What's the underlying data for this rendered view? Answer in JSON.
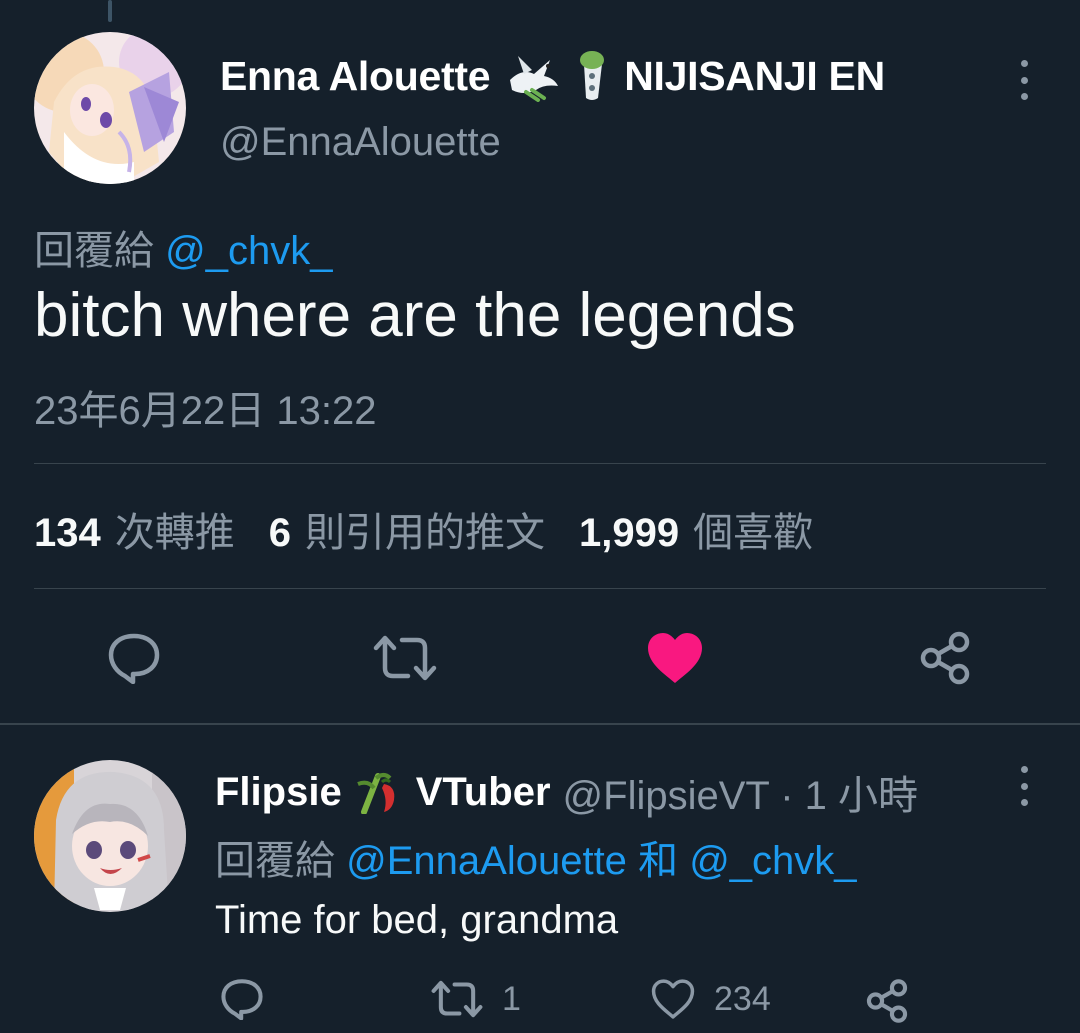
{
  "tweet": {
    "display_name": "Enna Alouette",
    "display_name_suffix": "NIJISANJI EN",
    "handle": "@EnnaAlouette",
    "reply_to_label": "回覆給",
    "reply_to_mention": "@_chvk_",
    "text": "bitch where are the legends",
    "timestamp": "23年6月22日 13:22",
    "stats": [
      {
        "value": "134",
        "label": "次轉推"
      },
      {
        "value": "6",
        "label": "則引用的推文"
      },
      {
        "value": "1,999",
        "label": "個喜歡"
      }
    ],
    "actions": [
      "reply-icon",
      "retweet-icon",
      "like-icon",
      "share-icon"
    ],
    "liked": true
  },
  "reply": {
    "display_name": "Flipsie",
    "display_name_suffix": "VTuber",
    "handle": "@FlipsieVT · 1 小時",
    "reply_to_label": "回覆給",
    "reply_to_mention_1": "@EnnaAlouette",
    "reply_to_and": "和",
    "reply_to_mention_2": "@_chvk_",
    "text": "Time for bed, grandma",
    "retweet_count": "1",
    "like_count": "234"
  },
  "colors": {
    "background": "#15202b",
    "secondary_text": "#8b98a5",
    "link": "#1d9bf0",
    "like": "#f91880",
    "divider": "#38444d"
  }
}
